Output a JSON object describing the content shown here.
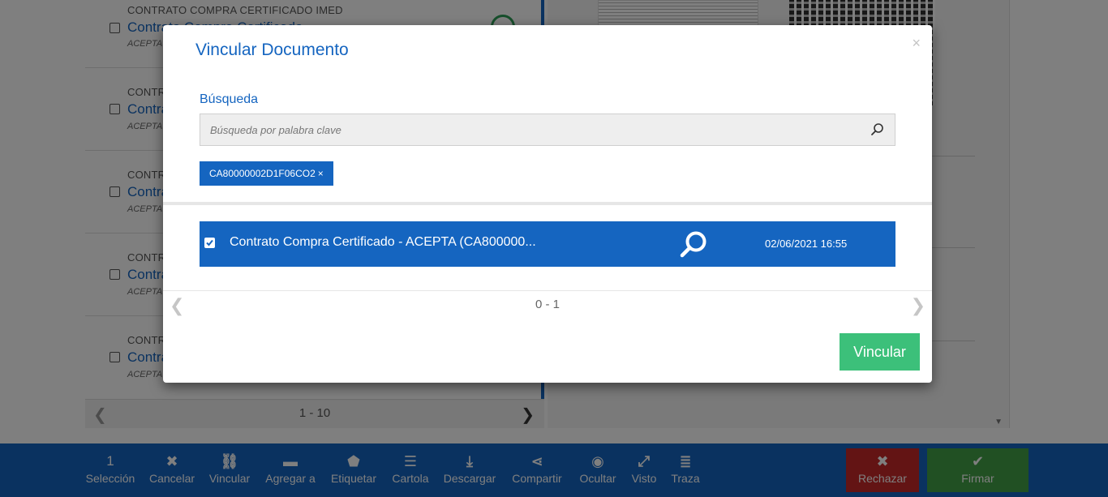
{
  "background": {
    "documents": [
      {
        "category": "CONTRATO COMPRA CERTIFICADO IMED",
        "title": "Contrato Compra Certificado",
        "subtitle": "ACEPTA - ..."
      },
      {
        "category": "CONTRATO COMPRA CERTIFICADO",
        "title": "Contrato Compra Certificado",
        "subtitle": "ACEPTA - ..."
      },
      {
        "category": "CONTRATO COMPRA CERTIFICADO",
        "title": "Contrato Compra Certificado",
        "subtitle": "ACEPTA - ..."
      },
      {
        "category": "CONTRATO COMPRA CERTIFICADO",
        "title": "Contrato Compra Certificado",
        "subtitle": "ACEPTA - ..."
      },
      {
        "category": "CONTRATO COMPRA CERTIFICADO",
        "title": "Contrato Compra Certificado",
        "subtitle": "ACEPTA - ..."
      }
    ],
    "list_pager": "1 - 10"
  },
  "toolbar": {
    "selection_count": "1",
    "selection_label": "Selección",
    "actions": [
      {
        "icon": "cancel-icon",
        "glyph": "✖",
        "label": "Cancelar"
      },
      {
        "icon": "link-icon",
        "glyph": "⛓",
        "label": "Vincular"
      },
      {
        "icon": "folder-icon",
        "glyph": "▬",
        "label": "Agregar a"
      },
      {
        "icon": "tag-icon",
        "glyph": "⬟",
        "label": "Etiquetar"
      },
      {
        "icon": "list-icon",
        "glyph": "☰",
        "label": "Cartola"
      },
      {
        "icon": "download-icon",
        "glyph": "⤓",
        "label": "Descargar"
      },
      {
        "icon": "share-icon",
        "glyph": "⋖",
        "label": "Compartir"
      },
      {
        "icon": "eye-slash-icon",
        "glyph": "◉",
        "label": "Ocultar"
      },
      {
        "icon": "expand-icon",
        "glyph": "⤢",
        "label": "Visto"
      },
      {
        "icon": "trace-icon",
        "glyph": "≣",
        "label": "Traza"
      }
    ],
    "reject_label": "Rechazar",
    "sign_label": "Firmar",
    "colors": {
      "bar": "#1565c0",
      "reject": "#c62828",
      "sign": "#43a047"
    }
  },
  "modal": {
    "title": "Vincular Documento",
    "close": "×",
    "search": {
      "label": "Búsqueda",
      "placeholder": "Búsqueda por palabra clave",
      "value": ""
    },
    "tag": {
      "text": "CA80000002D1F06CO2",
      "remove": "×"
    },
    "results": [
      {
        "checked": true,
        "title": "Contrato Compra Certificado - ACEPTA (CA800000...",
        "date": "02/06/2021 16:55"
      }
    ],
    "pager": "0 - 1",
    "submit_label": "Vincular",
    "colors": {
      "accent": "#1565c0",
      "submit": "#3cc07a"
    }
  }
}
